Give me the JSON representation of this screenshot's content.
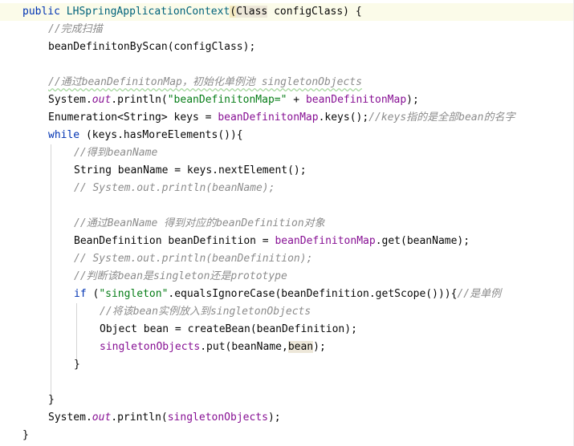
{
  "editor": {
    "language": "java",
    "colors": {
      "keyword": "#0033b3",
      "method_declaration": "#00627a",
      "string": "#067d17",
      "field": "#871094",
      "comment": "#8c8c8c",
      "default_text": "#080808",
      "caret_line": "#fbfbe9",
      "usage_highlight": "#ede7d9",
      "brace_highlight": "#f5eac1"
    },
    "lines": [
      {
        "indent": 0,
        "tokens": [
          {
            "t": "public ",
            "c": "kw"
          },
          {
            "t": "LHSpringApplicationContext",
            "c": "fn-def"
          },
          {
            "t": "(",
            "c": "hl-y"
          },
          {
            "t": "Class",
            "c": "hl-g"
          },
          {
            "t": " configClass) {",
            "c": ""
          }
        ]
      },
      {
        "indent": 1,
        "tokens": [
          {
            "t": "//完成扫描",
            "c": "cm"
          }
        ]
      },
      {
        "indent": 1,
        "tokens": [
          {
            "t": "beanDefinitonByScan(configClass);",
            "c": ""
          }
        ]
      },
      {
        "indent": 1,
        "tokens": []
      },
      {
        "indent": 1,
        "tokens": [
          {
            "t": "//通过beanDefinitonMap，初始化单例池 singletonObjects",
            "c": "cm"
          }
        ]
      },
      {
        "indent": 1,
        "tokens": [
          {
            "t": "System.",
            "c": ""
          },
          {
            "t": "out",
            "c": "fld-i"
          },
          {
            "t": ".println(",
            "c": ""
          },
          {
            "t": "\"beanDefinitonMap=\"",
            "c": "str"
          },
          {
            "t": " + ",
            "c": ""
          },
          {
            "t": "beanDefinitonMap",
            "c": "fld"
          },
          {
            "t": ");",
            "c": ""
          }
        ]
      },
      {
        "indent": 1,
        "tokens": [
          {
            "t": "Enumeration<String> keys = ",
            "c": ""
          },
          {
            "t": "beanDefinitonMap",
            "c": "fld"
          },
          {
            "t": ".keys();",
            "c": ""
          },
          {
            "t": "//keys指的是全部bean的名字",
            "c": "cm"
          }
        ]
      },
      {
        "indent": 1,
        "tokens": [
          {
            "t": "while",
            "c": "kw"
          },
          {
            "t": " (keys.hasMoreElements()){",
            "c": ""
          }
        ]
      },
      {
        "indent": 2,
        "tokens": [
          {
            "t": "//得到beanName",
            "c": "cm"
          }
        ]
      },
      {
        "indent": 2,
        "tokens": [
          {
            "t": "String beanName = keys.nextElement();",
            "c": ""
          }
        ]
      },
      {
        "indent": 2,
        "tokens": [
          {
            "t": "// System.out.println(beanName);",
            "c": "cm"
          }
        ]
      },
      {
        "indent": 2,
        "tokens": []
      },
      {
        "indent": 2,
        "tokens": [
          {
            "t": "//通过BeanName 得到对应的beanDefinition对象",
            "c": "cm"
          }
        ]
      },
      {
        "indent": 2,
        "tokens": [
          {
            "t": "BeanDefinition beanDefinition = ",
            "c": ""
          },
          {
            "t": "beanDefinitonMap",
            "c": "fld"
          },
          {
            "t": ".get(beanName);",
            "c": ""
          }
        ]
      },
      {
        "indent": 2,
        "tokens": [
          {
            "t": "// System.out.println(beanDefinition);",
            "c": "cm"
          }
        ]
      },
      {
        "indent": 2,
        "tokens": [
          {
            "t": "//判断该bean是singleton还是prototype",
            "c": "cm"
          }
        ]
      },
      {
        "indent": 2,
        "tokens": [
          {
            "t": "if",
            "c": "kw"
          },
          {
            "t": " (",
            "c": ""
          },
          {
            "t": "\"singleton\"",
            "c": "str"
          },
          {
            "t": ".equalsIgnoreCase(beanDefinition.getScope())){",
            "c": ""
          },
          {
            "t": "//是单例",
            "c": "cm"
          }
        ]
      },
      {
        "indent": 3,
        "tokens": [
          {
            "t": "//将该bean实例放入到singletonObjects",
            "c": "cm"
          }
        ]
      },
      {
        "indent": 3,
        "tokens": [
          {
            "t": "Object bean = createBean(beanDefinition);",
            "c": ""
          }
        ]
      },
      {
        "indent": 3,
        "tokens": [
          {
            "t": "singletonObjects",
            "c": "fld"
          },
          {
            "t": ".put(beanName,",
            "c": ""
          },
          {
            "t": "bean",
            "c": "hl-g"
          },
          {
            "t": ");",
            "c": ""
          }
        ]
      },
      {
        "indent": 2,
        "tokens": [
          {
            "t": "}",
            "c": ""
          }
        ]
      },
      {
        "indent": 2,
        "tokens": []
      },
      {
        "indent": 1,
        "tokens": [
          {
            "t": "}",
            "c": ""
          }
        ]
      },
      {
        "indent": 1,
        "tokens": [
          {
            "t": "System.",
            "c": ""
          },
          {
            "t": "out",
            "c": "fld-i"
          },
          {
            "t": ".println(",
            "c": ""
          },
          {
            "t": "singletonObjects",
            "c": "fld"
          },
          {
            "t": ");",
            "c": ""
          }
        ]
      },
      {
        "indent": 0,
        "tokens": [
          {
            "t": "}",
            "c": ""
          }
        ]
      }
    ]
  }
}
